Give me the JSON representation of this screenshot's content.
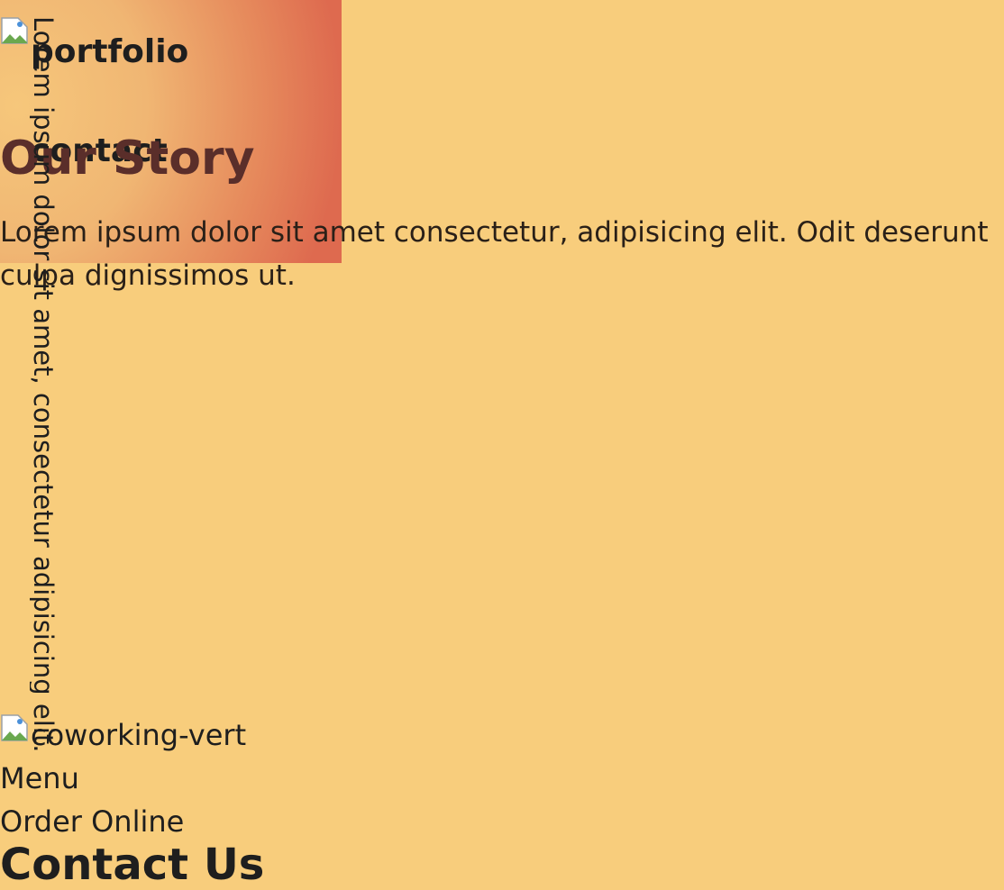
{
  "header": {
    "logo_alt": "portfolio",
    "contact_label": "contact"
  },
  "story": {
    "title": "Our Story",
    "text": "Lorem ipsum dolor sit amet consectetur, adipisicing elit. Odit deserunt culpa dignissimos ut."
  },
  "side_caption": "Lorem ipsum dolor sit amet, consectetur adipisicing elit.",
  "image_alt": "coworking-vert",
  "links": {
    "menu": "Menu",
    "order_online": "Order Online"
  },
  "contact": {
    "title": "Contact Us"
  },
  "colors": {
    "background": "#f8cd7c",
    "title": "#5a2e2a",
    "text": "#1e1e1e"
  },
  "icons": [
    "broken-image-icon"
  ]
}
